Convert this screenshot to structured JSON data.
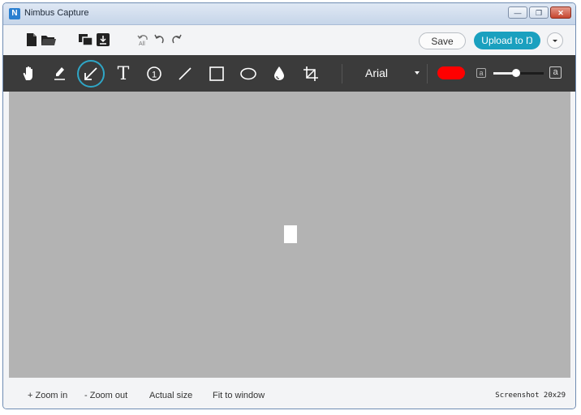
{
  "window": {
    "title": "Nimbus Capture",
    "app_icon_glyph": "N"
  },
  "toolbar": {
    "save_label": "Save",
    "upload_label": "Upload to Ŋ"
  },
  "draw_tools": {
    "icons": [
      "hand-icon",
      "marker-icon",
      "arrow-icon",
      "text-icon",
      "numbered-step-icon",
      "line-icon",
      "rectangle-icon",
      "ellipse-icon",
      "blur-icon",
      "crop-icon"
    ],
    "selected": "arrow-icon",
    "text_tool_glyph": "T",
    "step_glyph": "1"
  },
  "font": {
    "name": "Arial"
  },
  "color": {
    "current": "#ff0000"
  },
  "size_slider": {
    "value_fraction": 0.45,
    "small_glyph": "a",
    "large_glyph": "a"
  },
  "zoom": {
    "zoom_in": "+ Zoom in",
    "zoom_out": "- Zoom out",
    "actual_size": "Actual size",
    "fit_to_window": "Fit to window"
  },
  "status": {
    "text": "Screenshot 20x29"
  },
  "colors": {
    "accent": "#1aa0bf",
    "toolbar_bg": "#3b3b3b",
    "canvas_bg": "#b3b3b3"
  }
}
